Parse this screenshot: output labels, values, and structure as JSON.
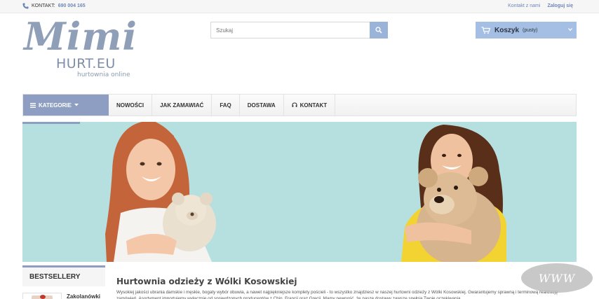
{
  "topbar": {
    "contact_label": "KONTAKT:",
    "phone": "690 004 165",
    "links": [
      "Kontakt z nami",
      "Zaloguj się"
    ]
  },
  "logo": {
    "word": "Mimi",
    "hurt": "HURT.EU",
    "tagline": "hurtownia online"
  },
  "search": {
    "placeholder": "Szukaj"
  },
  "cart": {
    "label": "Koszyk",
    "status": "(pusty)"
  },
  "nav": {
    "categories": "KATEGORIE",
    "items": [
      "NOWOŚCI",
      "JAK ZAMAWIAĆ",
      "FAQ",
      "DOSTAWA",
      "KONTAKT"
    ]
  },
  "sidebar": {
    "heading": "BESTSELLERY",
    "product_name": "Zakolanówki"
  },
  "main": {
    "title": "Hurtownia odzieży z Wólki Kosowskiej",
    "text": "Wysokiej jakości ubrania damskie i męskie, bogaty wybór obuwia, a nawet najpiękniejsze komplety pościeli - to wszystko znajdziesz w naszej hurtowni odzieży z Wólki Kosowskiej. Gwarantujemy sprawną i terminową realizację zamówień. Asortyment importujemy wyłącznie od sprawdzonych producentów z Chin, Francji oraz Grecji. Mamy pewność, że nasze dostawy zawsze spełnią Twoje oczekiwania."
  },
  "watermark": "WWW",
  "colors": {
    "accent": "#8e9ec3",
    "cart": "#a5bee3",
    "banner": "#b6e0e0",
    "link": "#6e87b7"
  }
}
